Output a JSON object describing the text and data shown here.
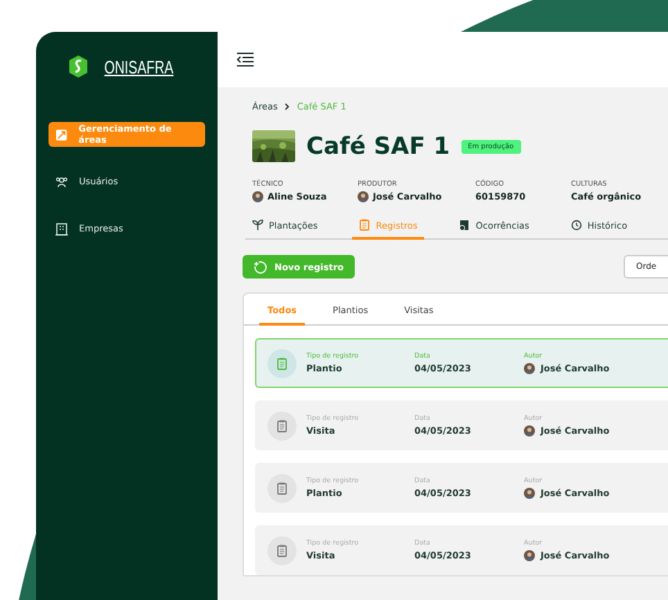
{
  "sidebar": {
    "logo": "ONISAFRA",
    "items": [
      {
        "label": "Gerenciamento de áreas",
        "selected": true
      },
      {
        "label": "Usuários",
        "selected": false
      },
      {
        "label": "Empresas",
        "selected": false
      }
    ]
  },
  "breadcrumb": [
    "Áreas",
    "Café SAF 1"
  ],
  "area": {
    "title": "Café SAF 1",
    "status": "Em produção"
  },
  "info": [
    {
      "label": "TÉCNICO",
      "value": "Aline Souza",
      "kind": "person"
    },
    {
      "label": "PRODUTOR",
      "value": "José Carvalho",
      "kind": "person"
    },
    {
      "label": "CÓDIGO",
      "value": "60159870",
      "kind": "text"
    },
    {
      "label": "CULTURAS",
      "value": "Café orgânico",
      "kind": "text"
    }
  ],
  "tabs": [
    {
      "label": "Plantações",
      "selected": false
    },
    {
      "label": "Registros",
      "selected": true
    },
    {
      "label": "Ocorrências",
      "selected": false
    },
    {
      "label": "Histórico",
      "selected": false
    }
  ],
  "new_button": "Novo registro",
  "sort_button": "Orde",
  "filters": [
    {
      "label": "Todos",
      "selected": true
    },
    {
      "label": "Plantios",
      "selected": false
    },
    {
      "label": "Visitas",
      "selected": false
    }
  ],
  "records": [
    {
      "type_label": "Tipo de registro",
      "type": "Plantio",
      "date_label": "Data",
      "date": "04/05/2023",
      "author_label": "Autor",
      "author": "José Carvalho",
      "selected": true
    },
    {
      "type_label": "Tipo de registro",
      "type": "Visita",
      "date_label": "Data",
      "date": "04/05/2023",
      "author_label": "Autor",
      "author": "José Carvalho",
      "selected": false
    },
    {
      "type_label": "Tipo de registro",
      "type": "Plantio",
      "date_label": "Data",
      "date": "04/05/2023",
      "author_label": "Autor",
      "author": "José Carvalho",
      "selected": false
    },
    {
      "type_label": "Tipo de registro",
      "type": "Visita",
      "date_label": "Data",
      "date": "04/05/2023",
      "author_label": "Autor",
      "author": "José Carvalho",
      "selected": false
    }
  ]
}
